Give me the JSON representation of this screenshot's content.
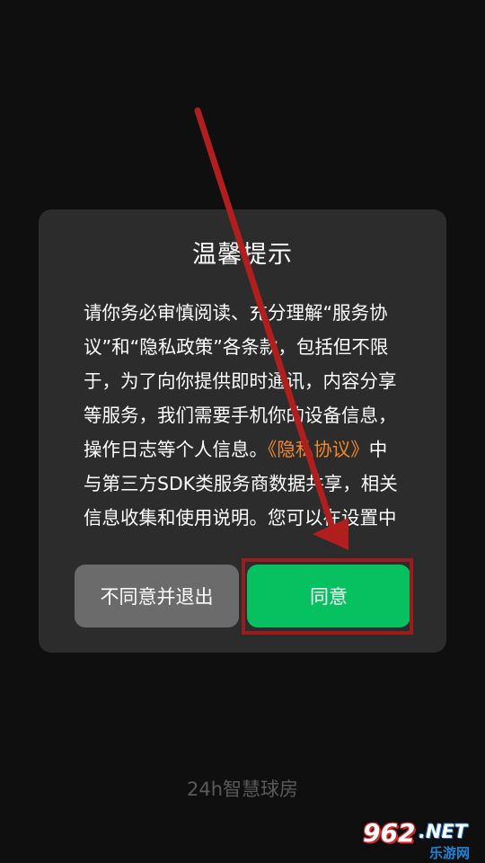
{
  "dialog": {
    "title": "温馨提示",
    "body_part1": "请你务必审慎阅读、充分理解“服务协议”和“隐私政策”各条款，包括但不限于，为了向你提供即时通讯，内容分享等服务，我们需要手机你的设备信息，操作日志等个人信息。",
    "body_link": "《隐私协议》",
    "body_part2": "中与第三方SDK类服务商数据共享，相关信息收集和使用说明。您可以在设置中查",
    "decline_label": "不同意并退出",
    "agree_label": "同意"
  },
  "footer": {
    "app_name": "24h智慧球房"
  },
  "watermark": {
    "number": "962",
    "domain": ".NET",
    "subtitle": "乐游网"
  },
  "colors": {
    "agree": "#07c160",
    "link": "#f2862e",
    "annotation": "#9b1c1c"
  }
}
